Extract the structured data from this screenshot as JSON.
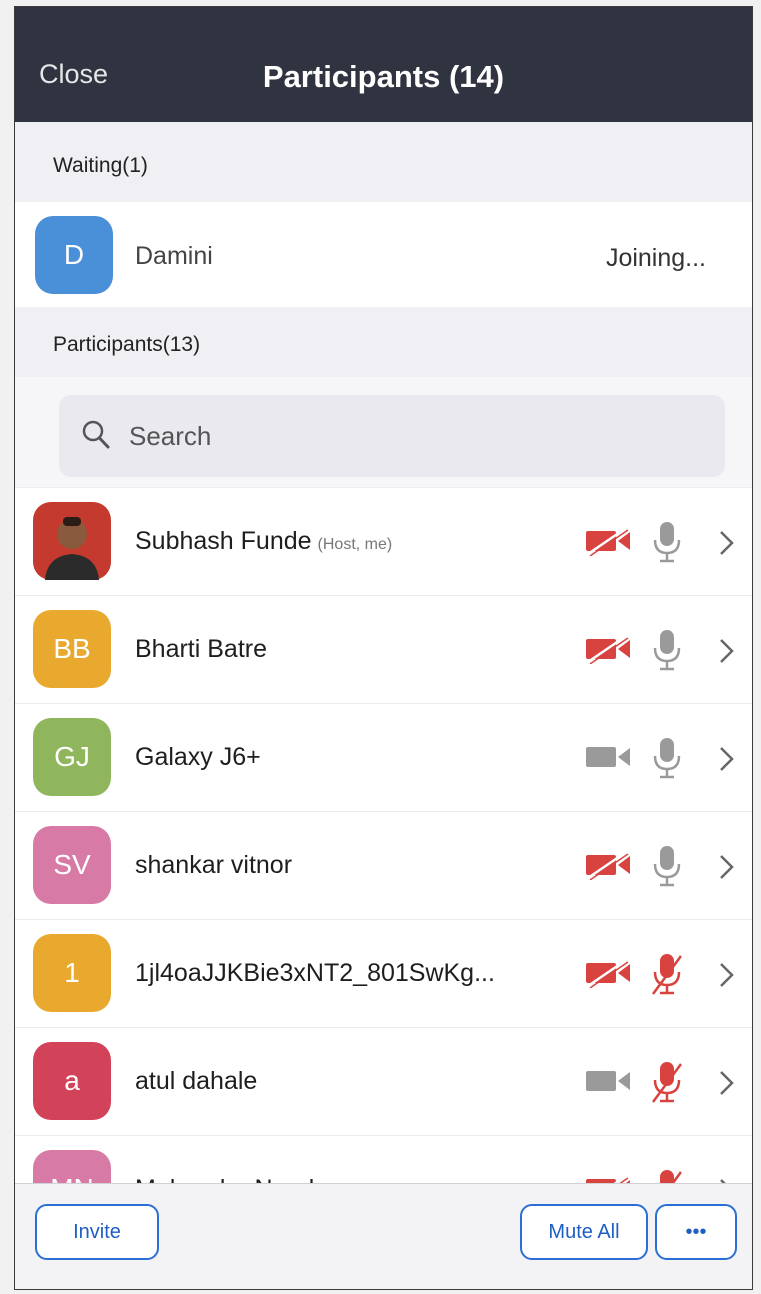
{
  "header": {
    "close_label": "Close",
    "title": "Participants (14)"
  },
  "waiting": {
    "section_label": "Waiting(1)",
    "items": [
      {
        "initials": "D",
        "name": "Damini",
        "status": "Joining...",
        "avatar_color": "#4a90d9"
      }
    ]
  },
  "participants_section_label": "Participants(13)",
  "search": {
    "placeholder": "Search"
  },
  "participants": [
    {
      "name": "Subhash Funde",
      "role": "(Host, me)",
      "initials": "",
      "avatar_color": "#c43a2e",
      "avatar_type": "photo",
      "video": "off",
      "audio": "on"
    },
    {
      "name": "Bharti Batre",
      "initials": "BB",
      "avatar_color": "#e8a92e",
      "video": "off",
      "audio": "on"
    },
    {
      "name": "Galaxy J6+",
      "initials": "GJ",
      "avatar_color": "#8fb65c",
      "video": "on",
      "audio": "on"
    },
    {
      "name": "shankar vitnor",
      "initials": "SV",
      "avatar_color": "#d77aa6",
      "video": "off",
      "audio": "on"
    },
    {
      "name": "1jl4oaJJKBie3xNT2_801SwKg...",
      "initials": "1",
      "avatar_color": "#e8a92e",
      "video": "off",
      "audio": "muted"
    },
    {
      "name": "atul dahale",
      "initials": "a",
      "avatar_color": "#d2435a",
      "video": "on",
      "audio": "muted"
    },
    {
      "name": "Mahendra Nanda",
      "initials": "MN",
      "avatar_color": "#d77aa6",
      "video": "off",
      "audio": "muted"
    }
  ],
  "footer": {
    "invite_label": "Invite",
    "mute_all_label": "Mute All",
    "more_label": "•••"
  },
  "colors": {
    "header_bg": "#2f3440",
    "accent": "#2b6fd6",
    "muted_red": "#d9433f",
    "icon_gray": "#9a9a9a"
  }
}
